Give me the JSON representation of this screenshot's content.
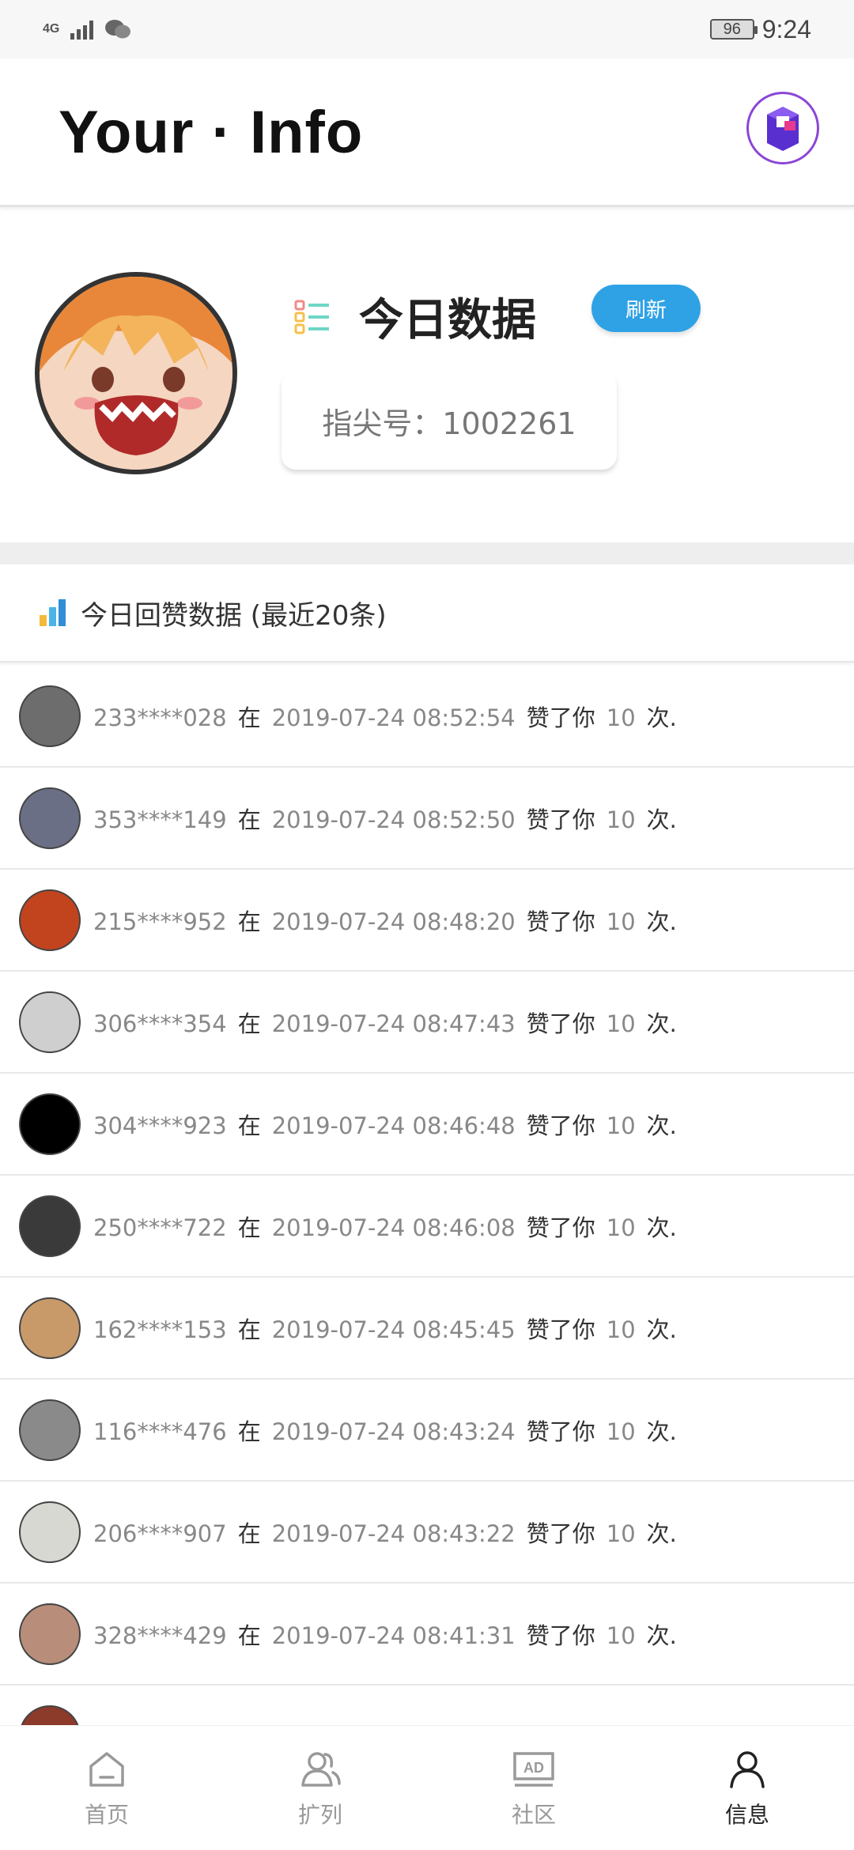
{
  "status_bar": {
    "network": "4G",
    "battery": "96",
    "time": "9:24"
  },
  "header": {
    "title": "Your · Info"
  },
  "profile": {
    "today_title": "今日数据",
    "refresh_label": "刷新",
    "id_text": "指尖号：1002261"
  },
  "section": {
    "title": "今日回赞数据 (最近20条)"
  },
  "likes": [
    {
      "user": "233****028",
      "at": "在",
      "time": "2019-07-24 08:52:54",
      "action": "赞了你",
      "count": "10",
      "unit": "次.",
      "avatar_color": "#6d6d6d"
    },
    {
      "user": "353****149",
      "at": "在",
      "time": "2019-07-24 08:52:50",
      "action": "赞了你",
      "count": "10",
      "unit": "次.",
      "avatar_color": "#6b6f86"
    },
    {
      "user": "215****952",
      "at": "在",
      "time": "2019-07-24 08:48:20",
      "action": "赞了你",
      "count": "10",
      "unit": "次.",
      "avatar_color": "#c2441f"
    },
    {
      "user": "306****354",
      "at": "在",
      "time": "2019-07-24 08:47:43",
      "action": "赞了你",
      "count": "10",
      "unit": "次.",
      "avatar_color": "#cfcfcf"
    },
    {
      "user": "304****923",
      "at": "在",
      "time": "2019-07-24 08:46:48",
      "action": "赞了你",
      "count": "10",
      "unit": "次.",
      "avatar_color": "#000000"
    },
    {
      "user": "250****722",
      "at": "在",
      "time": "2019-07-24 08:46:08",
      "action": "赞了你",
      "count": "10",
      "unit": "次.",
      "avatar_color": "#3a3a3a"
    },
    {
      "user": "162****153",
      "at": "在",
      "time": "2019-07-24 08:45:45",
      "action": "赞了你",
      "count": "10",
      "unit": "次.",
      "avatar_color": "#c89a6a"
    },
    {
      "user": "116****476",
      "at": "在",
      "time": "2019-07-24 08:43:24",
      "action": "赞了你",
      "count": "10",
      "unit": "次.",
      "avatar_color": "#8a8a8a"
    },
    {
      "user": "206****907",
      "at": "在",
      "time": "2019-07-24 08:43:22",
      "action": "赞了你",
      "count": "10",
      "unit": "次.",
      "avatar_color": "#d8d8d2"
    },
    {
      "user": "328****429",
      "at": "在",
      "time": "2019-07-24 08:41:31",
      "action": "赞了你",
      "count": "10",
      "unit": "次.",
      "avatar_color": "#b88e7a"
    },
    {
      "user": "",
      "at": "",
      "time": "",
      "action": "",
      "count": "",
      "unit": "",
      "avatar_color": "#8c3a2a"
    }
  ],
  "nav": [
    {
      "label": "首页",
      "icon": "home-icon",
      "active": false
    },
    {
      "label": "扩列",
      "icon": "friends-icon",
      "active": false
    },
    {
      "label": "社区",
      "icon": "ad-icon",
      "active": false
    },
    {
      "label": "信息",
      "icon": "profile-icon",
      "active": true
    }
  ],
  "colors": {
    "accent_blue": "#2fa2e6",
    "avatar_ring": "#8b46d6"
  }
}
